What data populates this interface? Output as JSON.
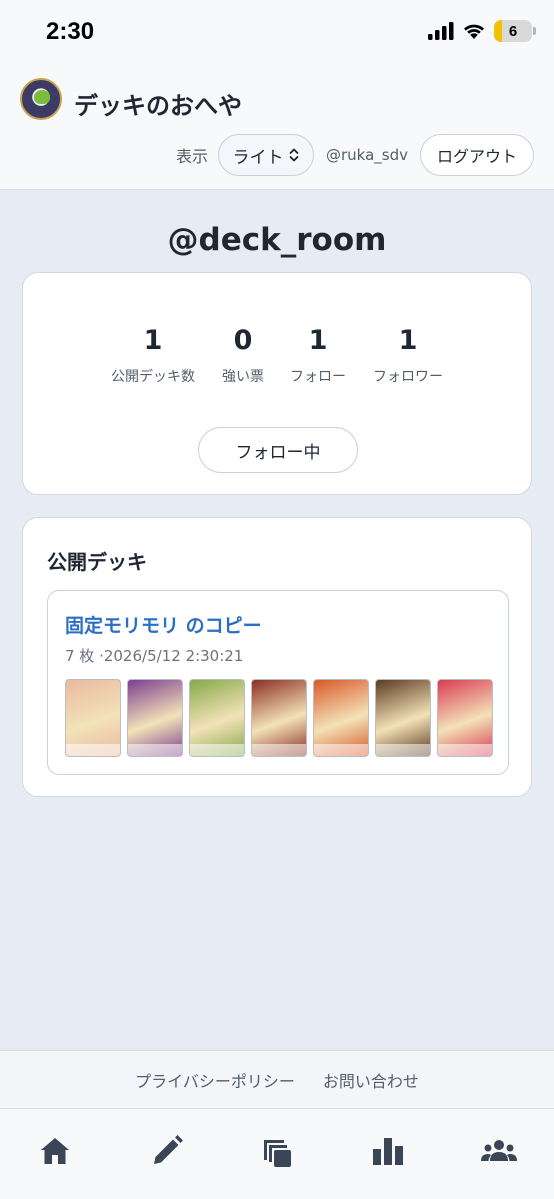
{
  "status_bar": {
    "time": "2:30",
    "battery": "6"
  },
  "header": {
    "title": "デッキのおへや",
    "theme_label": "表示",
    "theme_value": "ライト",
    "username": "@ruka_sdv",
    "logout_label": "ログアウト"
  },
  "profile": {
    "handle": "@deck_room",
    "stats": [
      {
        "value": "1",
        "label": "公開デッキ数"
      },
      {
        "value": "0",
        "label": "強い票"
      },
      {
        "value": "1",
        "label": "フォロー"
      },
      {
        "value": "1",
        "label": "フォロワー"
      }
    ],
    "follow_button": "フォロー中"
  },
  "public_decks": {
    "title": "公開デッキ",
    "decks": [
      {
        "name": "固定モリモリ のコピー",
        "meta": "7 枚 ·2026/5/12 2:30:21",
        "card_colors": [
          "#e9b9a0",
          "#7b3f8f",
          "#86a94a",
          "#8a2f24",
          "#d8592a",
          "#5b3a22",
          "#d93b52"
        ]
      }
    ]
  },
  "footer": {
    "privacy": "プライバシーポリシー",
    "contact": "お問い合わせ"
  },
  "tabs": [
    "home-icon",
    "edit-icon",
    "decks-icon",
    "stats-icon",
    "community-icon"
  ],
  "colors": {
    "accent": "#2a6fc4",
    "icon": "#3a4556",
    "background": "#e6ebf4"
  }
}
